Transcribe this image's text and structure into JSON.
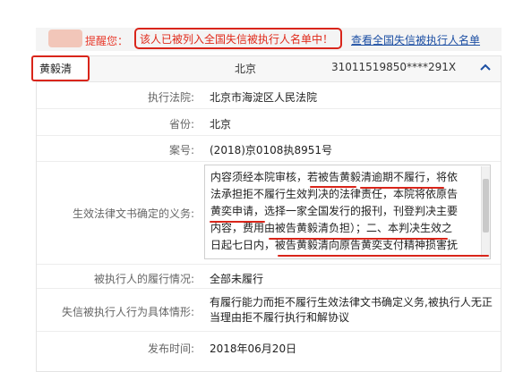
{
  "alert": {
    "label": "提醒您：",
    "message": "该人已被列入全国失信被执行人名单中！",
    "link": "查看全国失信被执行人名单"
  },
  "record": {
    "name": "黄毅清",
    "region": "北京",
    "id_number": "31011519850****291X"
  },
  "fields": {
    "court_label": "执行法院:",
    "court_value": "北京市海淀区人民法院",
    "province_label": "省份:",
    "province_value": "北京",
    "case_label": "案号:",
    "case_value": "(2018)京0108执8951号",
    "obligation_label": "生效法律文书确定的义务:",
    "obligation_lines": [
      "内容须经本院审核，若被告黄毅清逾期不履行，将依",
      "法承担拒不履行生效判决的法律责任，本院将依原告",
      "黄奕申请，选择一家全国发行的报刊，刊登判决主要",
      "内容，费用由被告黄毅清负担）；二、本判决生效之",
      "日起七日内，被告黄毅清向原告黄奕支付精神损害抚"
    ],
    "performance_label": "被执行人的履行情况:",
    "performance_value": "全部未履行",
    "behavior_label": "失信被执行人行为具体情形:",
    "behavior_value": "有履行能力而拒不履行生效法律文书确定义务,被执行人无正当理由拒不履行执行和解协议",
    "date_label": "发布时间:",
    "date_value": "2018年06月20日"
  },
  "colors": {
    "alert_red": "#e02a1a",
    "link_blue": "#1d4fa3",
    "highlight_red": "#d9251a"
  },
  "icons": {
    "collapse": "chevron-up-icon"
  }
}
